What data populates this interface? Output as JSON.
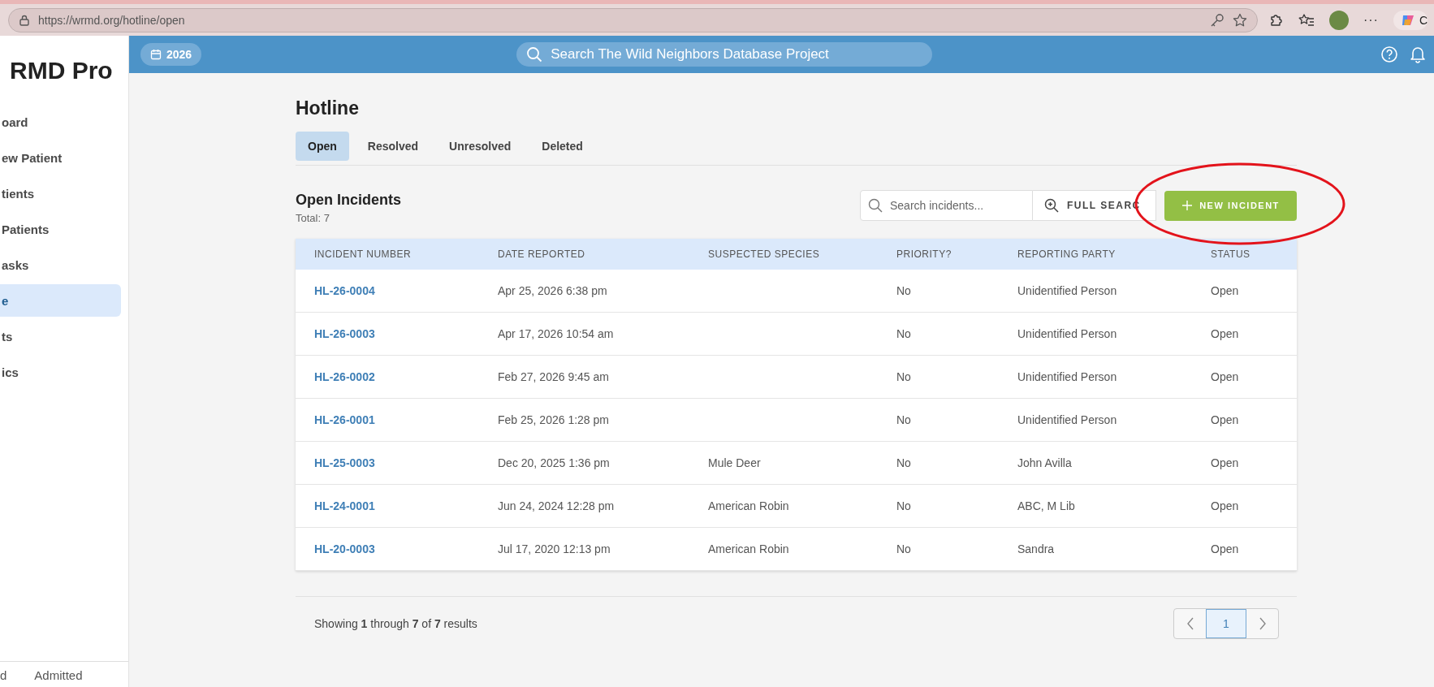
{
  "browser": {
    "url": "https://wrmd.org/hotline/open",
    "menu_glyph": "···",
    "profile_label": "C"
  },
  "sidebar": {
    "logo": "RMD Pro",
    "items": [
      {
        "label": "oard",
        "selected": false
      },
      {
        "label": "ew Patient",
        "selected": false
      },
      {
        "label": "tients",
        "selected": false
      },
      {
        "label": "Patients",
        "selected": false
      },
      {
        "label": "asks",
        "selected": false
      },
      {
        "label": "e",
        "selected": true
      },
      {
        "label": "ts",
        "selected": false
      },
      {
        "label": "ics",
        "selected": false
      }
    ],
    "footer_tabs": [
      "d",
      "Admitted"
    ]
  },
  "topbar": {
    "year": "2026",
    "search_placeholder": "Search The Wild Neighbors Database Project"
  },
  "page": {
    "title": "Hotline",
    "tabs": [
      {
        "label": "Open",
        "selected": true
      },
      {
        "label": "Resolved",
        "selected": false
      },
      {
        "label": "Unresolved",
        "selected": false
      },
      {
        "label": "Deleted",
        "selected": false
      }
    ],
    "section_title": "Open Incidents",
    "total": "Total: 7",
    "search": {
      "placeholder": "Search incidents..."
    },
    "full_search": "FULL SEARC",
    "new_button": "NEW INCIDENT"
  },
  "table": {
    "columns": [
      "INCIDENT NUMBER",
      "DATE REPORTED",
      "SUSPECTED SPECIES",
      "PRIORITY?",
      "REPORTING PARTY",
      "STATUS"
    ],
    "rows": [
      [
        "HL-26-0004",
        "Apr 25, 2026 6:38 pm",
        "",
        "No",
        "Unidentified Person",
        "Open"
      ],
      [
        "HL-26-0003",
        "Apr 17, 2026 10:54 am",
        "",
        "No",
        "Unidentified Person",
        "Open"
      ],
      [
        "HL-26-0002",
        "Feb 27, 2026 9:45 am",
        "",
        "No",
        "Unidentified Person",
        "Open"
      ],
      [
        "HL-26-0001",
        "Feb 25, 2026 1:28 pm",
        "",
        "No",
        "Unidentified Person",
        "Open"
      ],
      [
        "HL-25-0003",
        "Dec 20, 2025 1:36 pm",
        "Mule Deer",
        "No",
        "John Avilla",
        "Open"
      ],
      [
        "HL-24-0001",
        "Jun 24, 2024 12:28 pm",
        "American Robin",
        "No",
        "ABC, M Lib",
        "Open"
      ],
      [
        "HL-20-0003",
        "Jul 17, 2020 12:13 pm",
        "American Robin",
        "No",
        "Sandra",
        "Open"
      ]
    ]
  },
  "pagination": {
    "summary": "Showing **1** through **7** of **7** results",
    "pages": [
      {
        "label": "1",
        "selected": true
      }
    ]
  },
  "annotations": [
    {
      "kind": "ellipse",
      "color": "#e3131b"
    }
  ]
}
